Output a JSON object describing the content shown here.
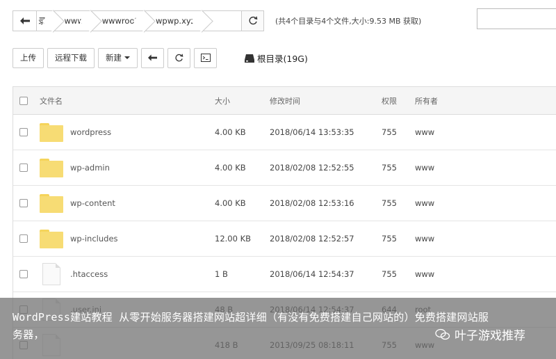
{
  "breadcrumb": {
    "items": [
      "录",
      "www",
      "wwwroot",
      "wpwp.xyz"
    ]
  },
  "summary": "(共4个目录与4个文件,大小:9.53 MB  获取)",
  "toolbar": {
    "upload": "上传",
    "remote_download": "远程下载",
    "new": "新建",
    "disk_label": "根目录(19G)"
  },
  "table": {
    "headers": {
      "name": "文件名",
      "size": "大小",
      "modified": "修改时间",
      "permission": "权限",
      "owner": "所有者"
    },
    "rows": [
      {
        "type": "folder",
        "name": "wordpress",
        "size": "4.00 KB",
        "modified": "2018/06/14 13:53:35",
        "permission": "755",
        "owner": "www"
      },
      {
        "type": "folder",
        "name": "wp-admin",
        "size": "4.00 KB",
        "modified": "2018/02/08 12:52:55",
        "permission": "755",
        "owner": "www"
      },
      {
        "type": "folder",
        "name": "wp-content",
        "size": "4.00 KB",
        "modified": "2018/02/08 12:53:16",
        "permission": "755",
        "owner": "www"
      },
      {
        "type": "folder",
        "name": "wp-includes",
        "size": "12.00 KB",
        "modified": "2018/02/08 12:52:57",
        "permission": "755",
        "owner": "www"
      },
      {
        "type": "file",
        "name": ".htaccess",
        "size": "1 B",
        "modified": "2018/06/14 12:54:37",
        "permission": "755",
        "owner": "www"
      },
      {
        "type": "file",
        "name": ".user.ini",
        "size": "48 B",
        "modified": "2018/06/14 12:54:37",
        "permission": "644",
        "owner": "root"
      },
      {
        "type": "file",
        "name": "",
        "size": "418 B",
        "modified": "2013/09/25 08:18:11",
        "permission": "755",
        "owner": "www"
      }
    ]
  },
  "overlay": {
    "caption": "WordPress建站教程 从零开始服务器搭建网站超详细（有没有免费搭建自己网站的）免费搭建网站服务器，",
    "watermark": "叶子游戏推荐"
  },
  "colors": {
    "folder": "#f7dc74",
    "header_bg": "#f5f5f5",
    "overlay": "#6e6e6e"
  }
}
